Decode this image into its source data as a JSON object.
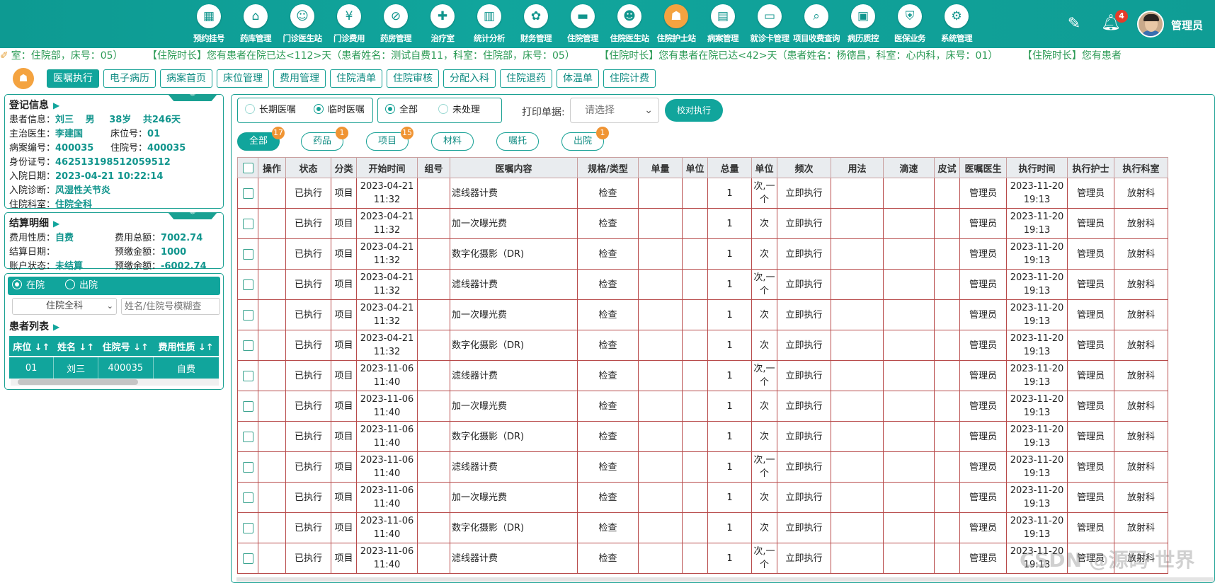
{
  "nav": [
    {
      "label": "预约挂号",
      "icon": "calendar-icon",
      "glyph": "▦"
    },
    {
      "label": "药库管理",
      "icon": "warehouse-icon",
      "glyph": "⌂"
    },
    {
      "label": "门诊医生站",
      "icon": "doctor-icon",
      "glyph": "☺"
    },
    {
      "label": "门诊费用",
      "icon": "yen-icon",
      "glyph": "¥"
    },
    {
      "label": "药房管理",
      "icon": "pill-icon",
      "glyph": "⊘"
    },
    {
      "label": "治疗室",
      "icon": "nurse-icon",
      "glyph": "✚"
    },
    {
      "label": "统计分析",
      "icon": "bar-chart-icon",
      "glyph": "▥"
    },
    {
      "label": "财务管理",
      "icon": "finance-icon",
      "glyph": "✿"
    },
    {
      "label": "住院管理",
      "icon": "bed-icon",
      "glyph": "▬"
    },
    {
      "label": "住院医生站",
      "icon": "inpatient-doctor-icon",
      "glyph": "☻"
    },
    {
      "label": "住院护士站",
      "icon": "inpatient-nurse-icon",
      "glyph": "☗"
    },
    {
      "label": "病案管理",
      "icon": "record-icon",
      "glyph": "▤"
    },
    {
      "label": "就诊卡管理",
      "icon": "card-icon",
      "glyph": "▭"
    },
    {
      "label": "项目收费查询",
      "icon": "search-doc-icon",
      "glyph": "⌕"
    },
    {
      "label": "病历质控",
      "icon": "quality-icon",
      "glyph": "▣"
    },
    {
      "label": "医保业务",
      "icon": "insurance-icon",
      "glyph": "⛨"
    },
    {
      "label": "系统管理",
      "icon": "gear-icon",
      "glyph": "⚙"
    }
  ],
  "header": {
    "notif_count": "4",
    "username": "管理员"
  },
  "marquee": [
    "室：住院部，床号：05）",
    "【住院时长】您有患者在院已达<112>天（患者姓名：测试自费11，科室：住院部，床号：05）",
    "【住院时长】您有患者在院已达<42>天（患者姓名：杨德昌，科室：心内科，床号：01）",
    "【住院时长】您有患者"
  ],
  "tabs": [
    "医嘱执行",
    "电子病历",
    "病案首页",
    "床位管理",
    "费用管理",
    "住院清单",
    "住院审核",
    "分配入科",
    "住院退药",
    "体温单",
    "住院计费"
  ],
  "registration": {
    "title": "登记信息",
    "patient_label": "患者信息：",
    "patient_name": "刘三",
    "patient_sex": "男",
    "patient_age": "38岁",
    "patient_days": "共246天",
    "doctor_label": "主治医生：",
    "doctor": "李建国",
    "bed_label": "床位号：",
    "bed": "01",
    "case_label": "病案编号：",
    "case_no": "400035",
    "hosp_label": "住院号：",
    "hosp_no": "400035",
    "id_label": "身份证号：",
    "id_no": "462513198512059512",
    "admit_label": "入院日期：",
    "admit_date": "2023-04-21 10:22:14",
    "diag_label": "入院诊断：",
    "diagnosis": "风湿性关节炎",
    "dept_label": "住院科室：",
    "dept": "住院全科"
  },
  "settlement": {
    "title": "结算明细",
    "nature_label": "费用性质：",
    "nature": "自费",
    "total_label": "费用总额：",
    "total": "7002.74",
    "date_label": "结算日期：",
    "date": "",
    "prepay_label": "预缴金额：",
    "prepay": "1000",
    "status_label": "账户状态：",
    "status": "未结算",
    "balance_label": "预缴余额：",
    "balance": "-6002.74"
  },
  "patient_list": {
    "in_label": "在院",
    "out_label": "出院",
    "dept_value": "住院全科",
    "search_placeholder": "姓名/住院号模糊查",
    "title": "患者列表",
    "headers": [
      "床位",
      "姓名",
      "住院号",
      "费用性质"
    ],
    "rows": [
      [
        "01",
        "刘三",
        "400035",
        "自费"
      ]
    ]
  },
  "toolbar": {
    "long_term": "长期医嘱",
    "temporary": "临时医嘱",
    "all": "全部",
    "unprocessed": "未处理",
    "print_label": "打印单据:",
    "print_placeholder": "请选择",
    "verify": "校对执行"
  },
  "filters": [
    {
      "label": "全部",
      "badge": "17",
      "active": true
    },
    {
      "label": "药品",
      "badge": "1"
    },
    {
      "label": "项目",
      "badge": "15"
    },
    {
      "label": "材料",
      "badge": ""
    },
    {
      "label": "嘱托",
      "badge": ""
    },
    {
      "label": "出院",
      "badge": "1"
    }
  ],
  "orders": {
    "headers": [
      "",
      "操作",
      "状态",
      "分类",
      "开始时间",
      "组号",
      "医嘱内容",
      "规格/类型",
      "单量",
      "单位",
      "总量",
      "单位",
      "频次",
      "用法",
      "滴速",
      "皮试",
      "医嘱医生",
      "执行时间",
      "执行护士",
      "执行科室"
    ],
    "rows": [
      [
        "已执行",
        "项目",
        "2023-04-21 11:32",
        "滤线器计费",
        "检查",
        "1",
        "次,一个",
        "立即执行",
        "管理员",
        "2023-11-20 19:13",
        "管理员",
        "放射科"
      ],
      [
        "已执行",
        "项目",
        "2023-04-21 11:32",
        "加一次曝光费",
        "检查",
        "1",
        "次",
        "立即执行",
        "管理员",
        "2023-11-20 19:13",
        "管理员",
        "放射科"
      ],
      [
        "已执行",
        "项目",
        "2023-04-21 11:32",
        "数字化摄影（DR)",
        "检查",
        "1",
        "次",
        "立即执行",
        "管理员",
        "2023-11-20 19:13",
        "管理员",
        "放射科"
      ],
      [
        "已执行",
        "项目",
        "2023-04-21 11:32",
        "滤线器计费",
        "检查",
        "1",
        "次,一个",
        "立即执行",
        "管理员",
        "2023-11-20 19:13",
        "管理员",
        "放射科"
      ],
      [
        "已执行",
        "项目",
        "2023-04-21 11:32",
        "加一次曝光费",
        "检查",
        "1",
        "次",
        "立即执行",
        "管理员",
        "2023-11-20 19:13",
        "管理员",
        "放射科"
      ],
      [
        "已执行",
        "项目",
        "2023-04-21 11:32",
        "数字化摄影（DR)",
        "检查",
        "1",
        "次",
        "立即执行",
        "管理员",
        "2023-11-20 19:13",
        "管理员",
        "放射科"
      ],
      [
        "已执行",
        "项目",
        "2023-11-06 11:40",
        "滤线器计费",
        "检查",
        "1",
        "次,一个",
        "立即执行",
        "管理员",
        "2023-11-20 19:13",
        "管理员",
        "放射科"
      ],
      [
        "已执行",
        "项目",
        "2023-11-06 11:40",
        "加一次曝光费",
        "检查",
        "1",
        "次",
        "立即执行",
        "管理员",
        "2023-11-20 19:13",
        "管理员",
        "放射科"
      ],
      [
        "已执行",
        "项目",
        "2023-11-06 11:40",
        "数字化摄影（DR)",
        "检查",
        "1",
        "次",
        "立即执行",
        "管理员",
        "2023-11-20 19:13",
        "管理员",
        "放射科"
      ],
      [
        "已执行",
        "项目",
        "2023-11-06 11:40",
        "滤线器计费",
        "检查",
        "1",
        "次,一个",
        "立即执行",
        "管理员",
        "2023-11-20 19:13",
        "管理员",
        "放射科"
      ],
      [
        "已执行",
        "项目",
        "2023-11-06 11:40",
        "加一次曝光费",
        "检查",
        "1",
        "次",
        "立即执行",
        "管理员",
        "2023-11-20 19:13",
        "管理员",
        "放射科"
      ],
      [
        "已执行",
        "项目",
        "2023-11-06 11:40",
        "数字化摄影（DR)",
        "检查",
        "1",
        "次",
        "立即执行",
        "管理员",
        "2023-11-20 19:13",
        "管理员",
        "放射科"
      ],
      [
        "已执行",
        "项目",
        "2023-11-06 11:40",
        "滤线器计费",
        "检查",
        "1",
        "次,一个",
        "立即执行",
        "管理员",
        "2023-11-20 19:13",
        "管理员",
        "放射科"
      ]
    ]
  },
  "watermark": "CSDN @源码 世界"
}
